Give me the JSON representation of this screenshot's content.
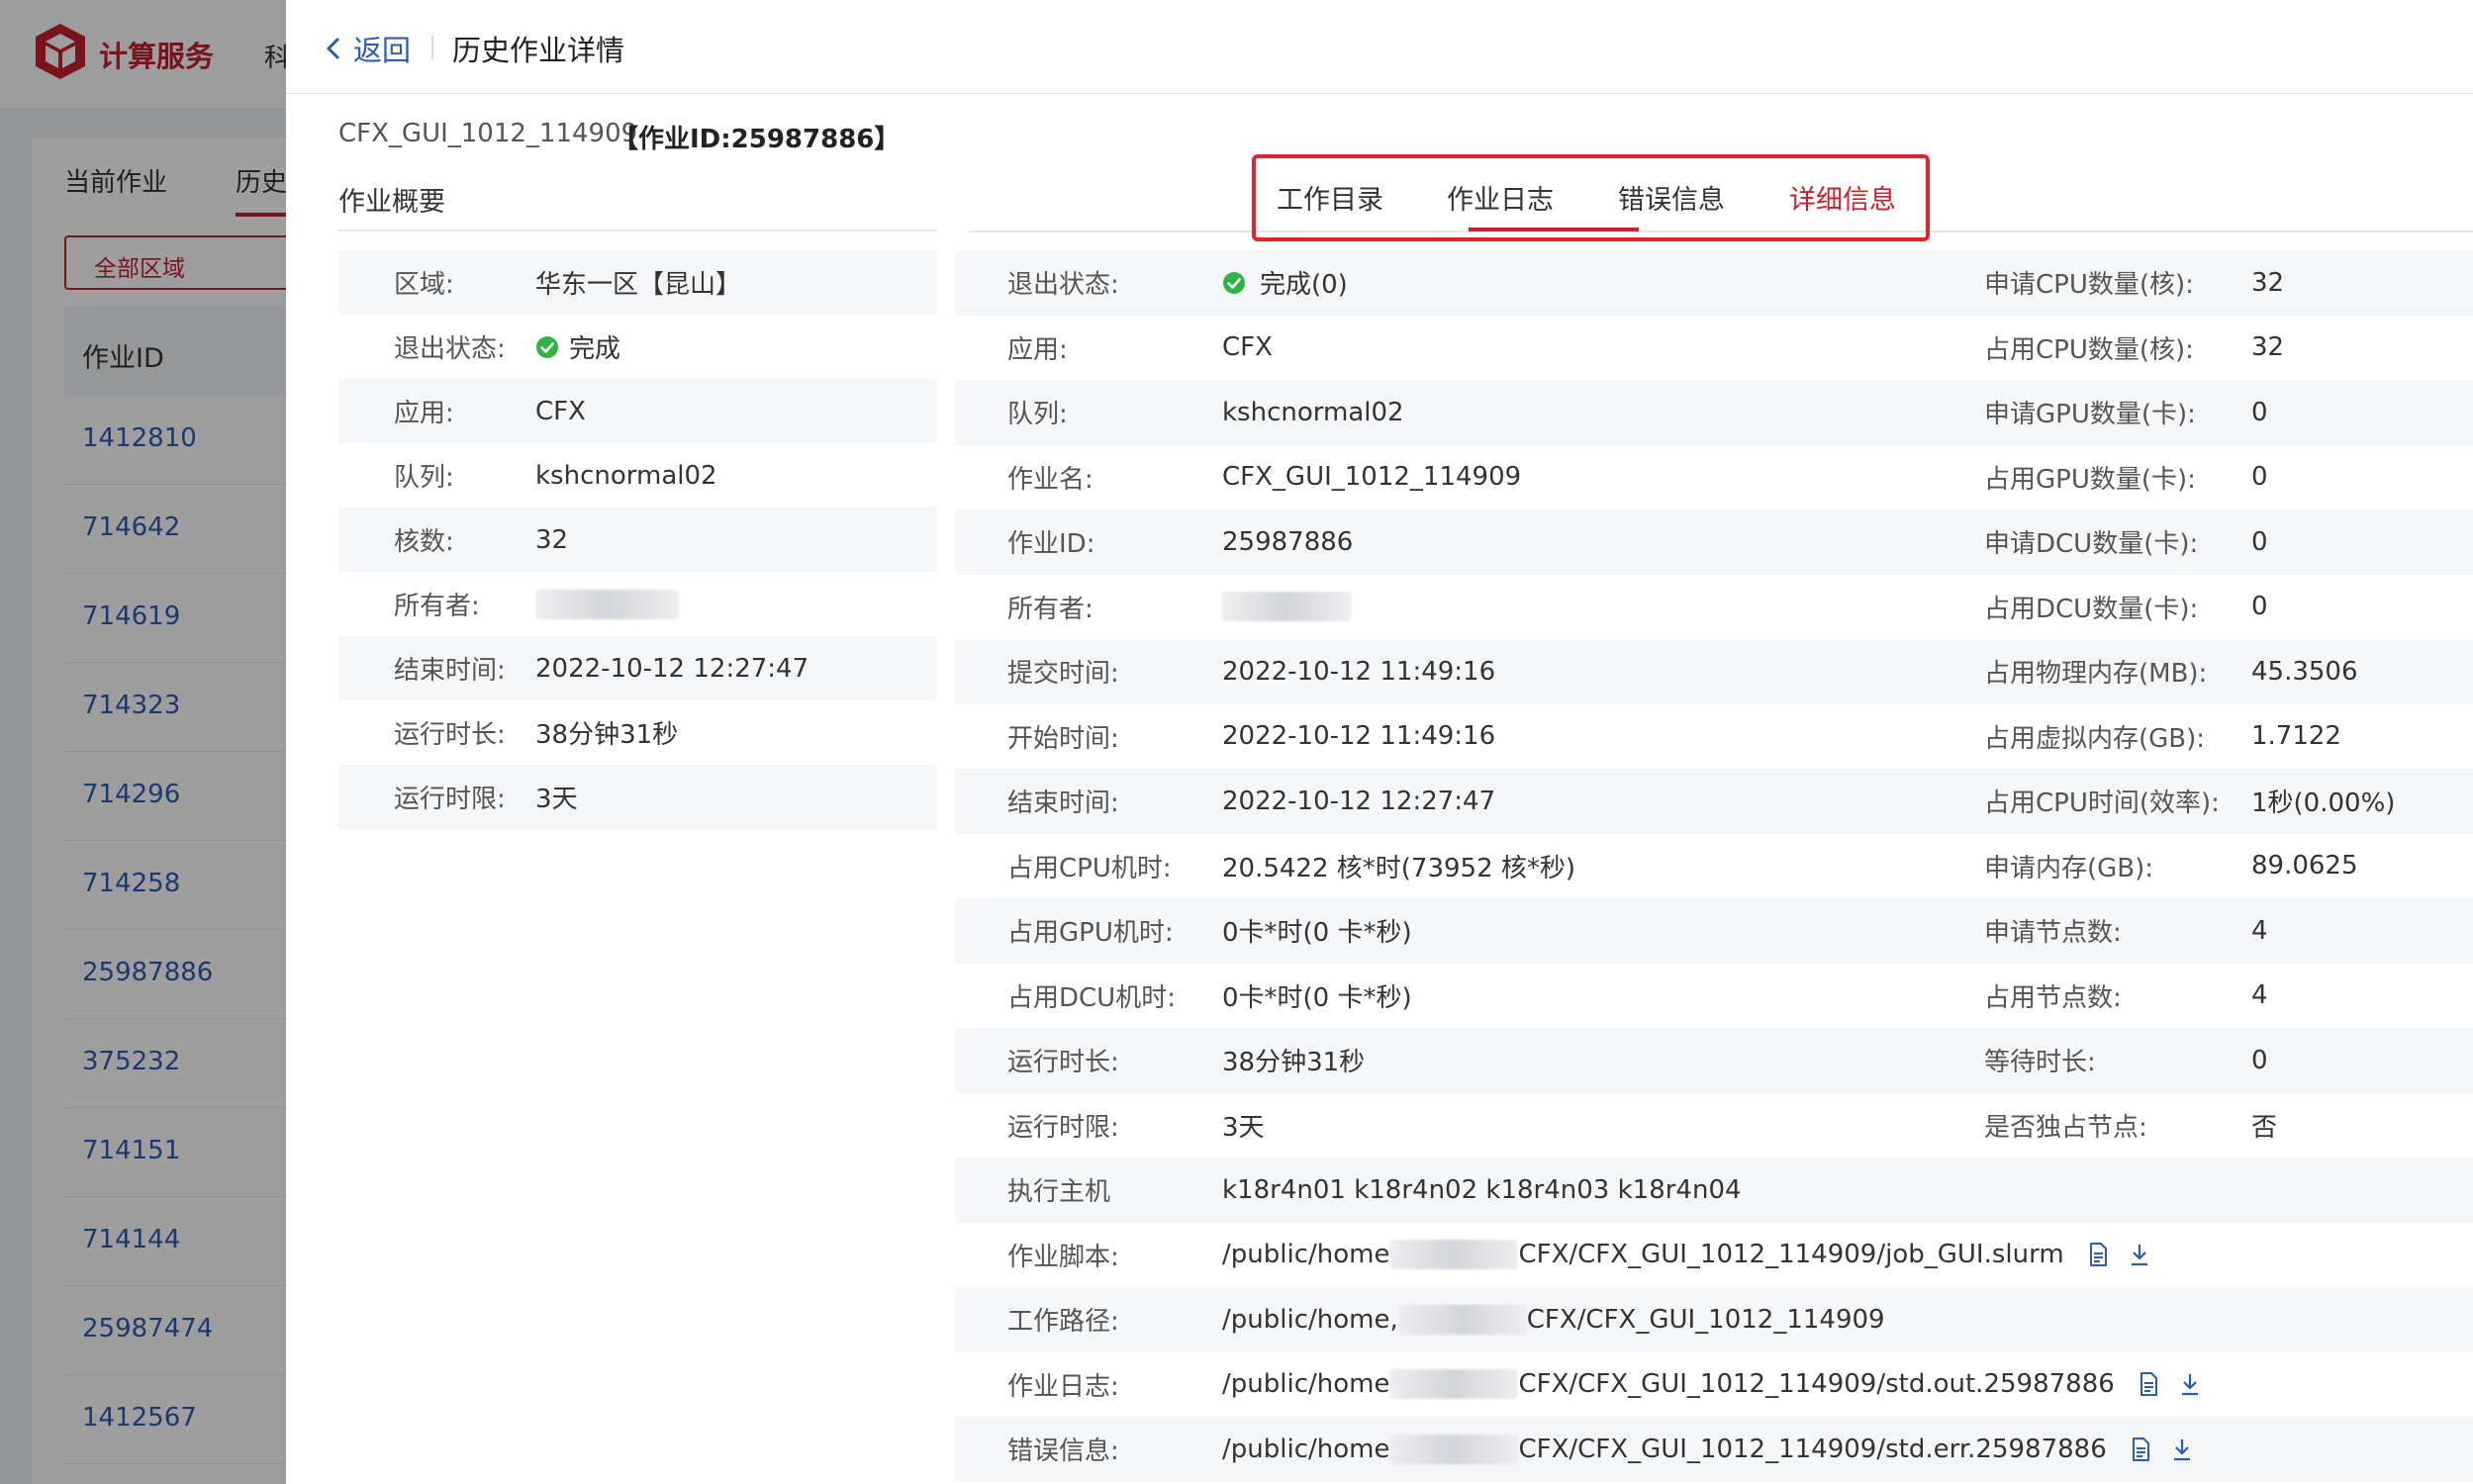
{
  "app": {
    "brand": "计算服务",
    "nav_cut": "科"
  },
  "background": {
    "tabs": [
      "当前作业",
      "历史"
    ],
    "region_button": "全部区域",
    "table_header": "作业ID",
    "job_ids": [
      "1412810",
      "714642",
      "714619",
      "714323",
      "714296",
      "714258",
      "25987886",
      "375232",
      "714151",
      "714144",
      "25987474",
      "1412567"
    ]
  },
  "drawer": {
    "back_label": "返回",
    "title": "历史作业详情",
    "job_name": "CFX_GUI_1012_114909",
    "job_id_label": "【作业ID:25987886】"
  },
  "overview": {
    "heading": "作业概要",
    "rows": [
      {
        "label": "区域:",
        "value": "华东一区【昆山】"
      },
      {
        "label": "退出状态:",
        "value": "完成",
        "status": "success"
      },
      {
        "label": "应用:",
        "value": "CFX"
      },
      {
        "label": "队列:",
        "value": "kshcnormal02"
      },
      {
        "label": "核数:",
        "value": "32"
      },
      {
        "label": "所有者:",
        "value": ""
      },
      {
        "label": "结束时间:",
        "value": "2022-10-12 12:27:47"
      },
      {
        "label": "运行时长:",
        "value": "38分钟31秒"
      },
      {
        "label": "运行时限:",
        "value": "3天"
      }
    ]
  },
  "tabs": [
    {
      "label": "工作目录",
      "active": false
    },
    {
      "label": "作业日志",
      "active": false
    },
    {
      "label": "错误信息",
      "active": false
    },
    {
      "label": "详细信息",
      "active": true
    }
  ],
  "details": {
    "rows": [
      {
        "label": "退出状态:",
        "value": "完成(0)",
        "label2": "申请CPU数量(核):",
        "value2": "32"
      },
      {
        "label": "应用:",
        "value": "CFX",
        "label2": "占用CPU数量(核):",
        "value2": "32"
      },
      {
        "label": "队列:",
        "value": "kshcnormal02",
        "label2": "申请GPU数量(卡):",
        "value2": "0"
      },
      {
        "label": "作业名:",
        "value": "CFX_GUI_1012_114909",
        "label2": "占用GPU数量(卡):",
        "value2": "0"
      },
      {
        "label": "作业ID:",
        "value": "25987886",
        "label2": "申请DCU数量(卡):",
        "value2": "0"
      },
      {
        "label": "所有者:",
        "value": "",
        "label2": "占用DCU数量(卡):",
        "value2": "0"
      },
      {
        "label": "提交时间:",
        "value": "2022-10-12 11:49:16",
        "label2": "占用物理内存(MB):",
        "value2": "45.3506"
      },
      {
        "label": "开始时间:",
        "value": "2022-10-12 11:49:16",
        "label2": "占用虚拟内存(GB):",
        "value2": "1.7122"
      },
      {
        "label": "结束时间:",
        "value": "2022-10-12 12:27:47",
        "label2": "占用CPU时间(效率):",
        "value2": "1秒(0.00%)"
      },
      {
        "label": "占用CPU机时:",
        "value": "20.5422 核*时(73952 核*秒)",
        "label2": "申请内存(GB):",
        "value2": "89.0625"
      },
      {
        "label": "占用GPU机时:",
        "value": "0卡*时(0 卡*秒)",
        "label2": "申请节点数:",
        "value2": "4"
      },
      {
        "label": "占用DCU机时:",
        "value": "0卡*时(0 卡*秒)",
        "label2": "占用节点数:",
        "value2": "4"
      },
      {
        "label": "运行时长:",
        "value": "38分钟31秒",
        "label2": "等待时长:",
        "value2": "0"
      },
      {
        "label": "运行时限:",
        "value": "3天",
        "label2": "是否独占节点:",
        "value2": "否"
      }
    ],
    "exec_host": {
      "label": "执行主机",
      "value": "k18r4n01 k18r4n02 k18r4n03 k18r4n04"
    },
    "paths": [
      {
        "label": "作业脚本:",
        "pre": "/public/home",
        "post": "CFX/CFX_GUI_1012_114909/job_GUI.slurm",
        "icons": true
      },
      {
        "label": "工作路径:",
        "pre": "/public/home,",
        "post": "CFX/CFX_GUI_1012_114909",
        "icons": false
      },
      {
        "label": "作业日志:",
        "pre": "/public/home",
        "post": "CFX/CFX_GUI_1012_114909/std.out.25987886",
        "icons": true
      },
      {
        "label": "错误信息:",
        "pre": "/public/home",
        "post": "CFX/CFX_GUI_1012_114909/std.err.25987886",
        "icons": true
      }
    ]
  },
  "colors": {
    "brand_red": "#c7202e",
    "link_blue": "#2a5db0",
    "success_green": "#2fb344",
    "highlight_red": "#e8202a"
  }
}
